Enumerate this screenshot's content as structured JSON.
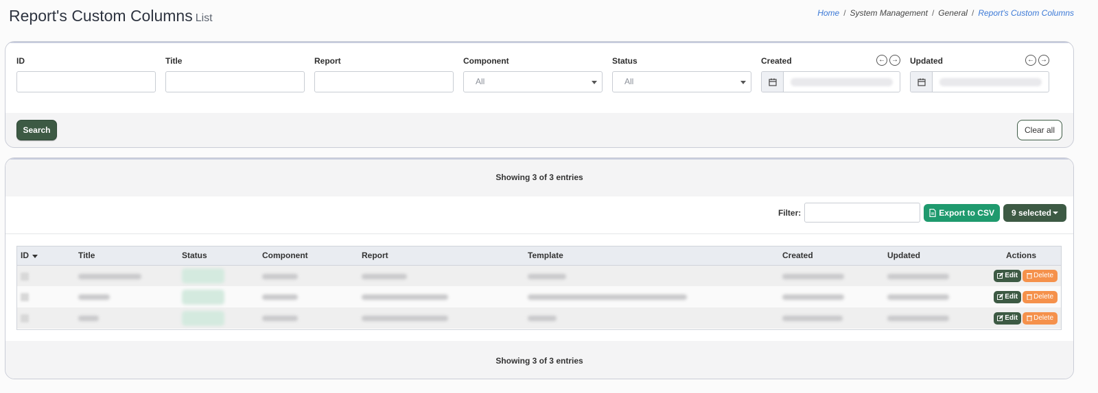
{
  "header": {
    "title": "Report's Custom Columns",
    "subtitle": "List",
    "breadcrumb": [
      "Home",
      "System Management",
      "General",
      "Report's Custom Columns"
    ]
  },
  "filters": {
    "id_label": "ID",
    "title_label": "Title",
    "report_label": "Report",
    "component_label": "Component",
    "component_value": "All",
    "status_label": "Status",
    "status_value": "All",
    "created_label": "Created",
    "updated_label": "Updated",
    "search_label": "Search",
    "clear_label": "Clear all"
  },
  "list": {
    "summary": "Showing 3 of 3 entries",
    "filter_label": "Filter:",
    "export_label": "Export to CSV",
    "selected_label": "9 selected",
    "columns": [
      "ID",
      "Title",
      "Status",
      "Component",
      "Report",
      "Template",
      "Created",
      "Updated",
      "Actions"
    ],
    "edit_label": "Edit",
    "delete_label": "Delete"
  },
  "colors": {
    "primary": "#3d5a44",
    "export": "#1f9a6e",
    "delete": "#f5914b",
    "link": "#3a78d6"
  }
}
